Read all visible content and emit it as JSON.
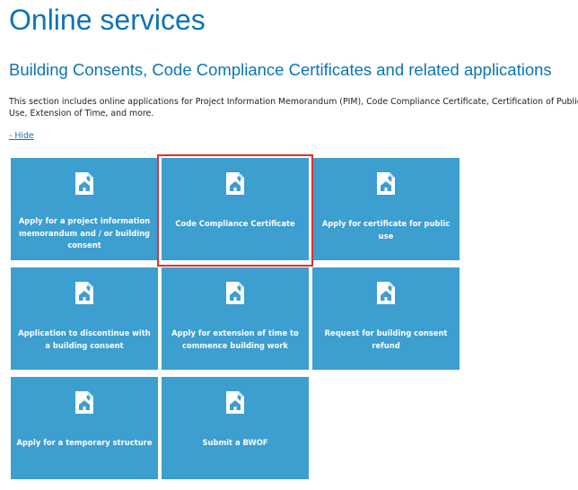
{
  "page": {
    "title": "Online services"
  },
  "section": {
    "heading": "Building Consents, Code Compliance Certificates and related applications",
    "description": "This section includes online applications for Project Information Memorandum (PIM), Code Compliance Certificate, Certification of Public Use, Extension of Time, and more.",
    "toggle_label": "- Hide"
  },
  "tiles": [
    {
      "label": "Apply for a project information memorandum and / or building consent",
      "icon": "document-house-icon"
    },
    {
      "label": "Code Compliance Certificate",
      "icon": "document-house-icon",
      "highlighted": true
    },
    {
      "label": "Apply for certificate for public use",
      "icon": "document-house-icon"
    },
    {
      "label": "Application to discontinue with a building consent",
      "icon": "document-house-icon"
    },
    {
      "label": "Apply for extension of time to commence building work",
      "icon": "document-house-icon"
    },
    {
      "label": "Request for building consent refund",
      "icon": "document-house-icon"
    },
    {
      "label": "Apply for a temporary structure",
      "icon": "document-house-icon"
    },
    {
      "label": "Submit a BWOF",
      "icon": "document-house-icon"
    }
  ],
  "colors": {
    "accent": "#0d74b6",
    "tile": "#3d9ed0",
    "highlight": "#e0312f"
  }
}
